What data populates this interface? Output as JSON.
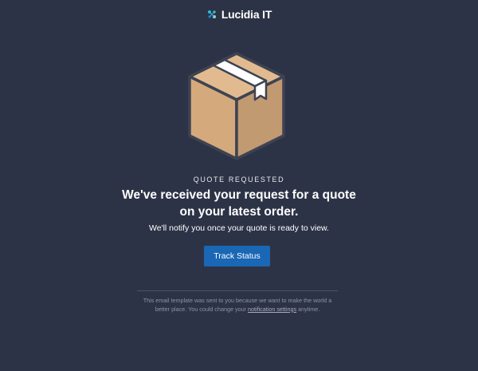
{
  "brand": {
    "name": "Lucidia IT",
    "mark_colors": [
      "#2fb7e8",
      "#4fd19a",
      "#1f6fd1",
      "#8fe0c4"
    ]
  },
  "hero": {
    "icon": "package-box-icon",
    "colors": {
      "box_front": "#d4a97b",
      "box_side": "#c19a72",
      "box_top": "#e1bb8f",
      "tape": "#ffffff",
      "outline": "#3e4352"
    }
  },
  "content": {
    "eyebrow": "QUOTE REQUESTED",
    "headline": "We've received your request for a quote on your latest order.",
    "subtext": "We'll notify you once your quote is ready to view.",
    "cta_label": "Track Status"
  },
  "footer": {
    "text_before": "This email template was sent to you because we want to make the world a better place. You could change your ",
    "link_label": "notification settings",
    "text_after": " anytime."
  },
  "colors": {
    "background": "#2d3346",
    "accent": "#1a67b5",
    "muted_text": "#8d93a5"
  }
}
